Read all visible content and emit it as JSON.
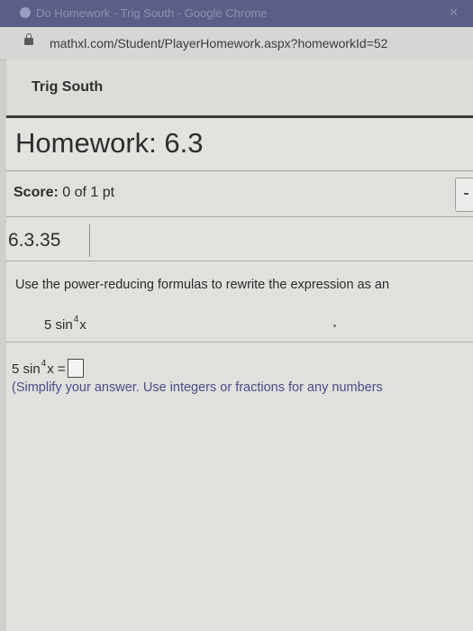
{
  "browser": {
    "tab_title": "Do Homework - Trig South - Google Chrome",
    "url": "mathxl.com/Student/PlayerHomework.aspx?homeworkId=52"
  },
  "course": {
    "title": "Trig South"
  },
  "homework": {
    "title": "Homework: 6.3"
  },
  "score": {
    "label": "Score:",
    "value": "0 of 1 pt"
  },
  "question": {
    "number": "6.3.35",
    "instructions": "Use the power-reducing formulas to rewrite the expression as an",
    "expression": {
      "coef": "5 sin",
      "power": "4",
      "var": "x"
    },
    "answer": {
      "coef": "5 sin",
      "power": "4",
      "var": "x ="
    },
    "hint": "(Simplify your answer. Use integers or fractions for any numbers"
  }
}
